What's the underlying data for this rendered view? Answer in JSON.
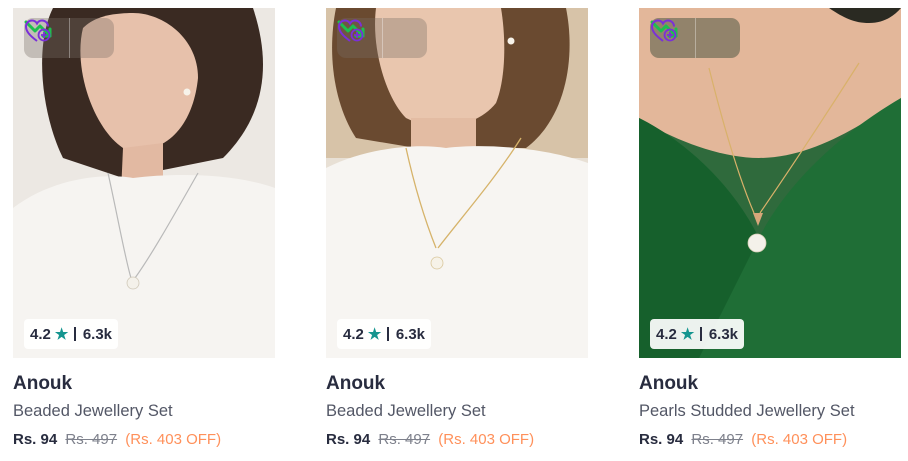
{
  "products": [
    {
      "brand": "Anouk",
      "name": "Beaded Jewellery Set",
      "rating": "4.2",
      "rating_count": "6.3k",
      "price": "Rs. 94",
      "mrp": "Rs. 497",
      "discount": "(Rs. 403 OFF)"
    },
    {
      "brand": "Anouk",
      "name": "Beaded Jewellery Set",
      "rating": "4.2",
      "rating_count": "6.3k",
      "price": "Rs. 94",
      "mrp": "Rs. 497",
      "discount": "(Rs. 403 OFF)"
    },
    {
      "brand": "Anouk",
      "name": "Pearls Studded Jewellery Set",
      "rating": "4.2",
      "rating_count": "6.3k",
      "price": "Rs. 94",
      "mrp": "Rs. 497",
      "discount": "(Rs. 403 OFF)"
    }
  ],
  "icons": {
    "price_drop": "trend-down-arrow-icon",
    "wishlist": "heart-plus-icon",
    "rating_star": "star-icon"
  },
  "colors": {
    "price_drop_green": "#1dbf4f",
    "wishlist_purple": "#7b2fd9",
    "star_teal": "#14958f",
    "discount_orange": "#ff905a",
    "text_dark": "#282c3f"
  }
}
